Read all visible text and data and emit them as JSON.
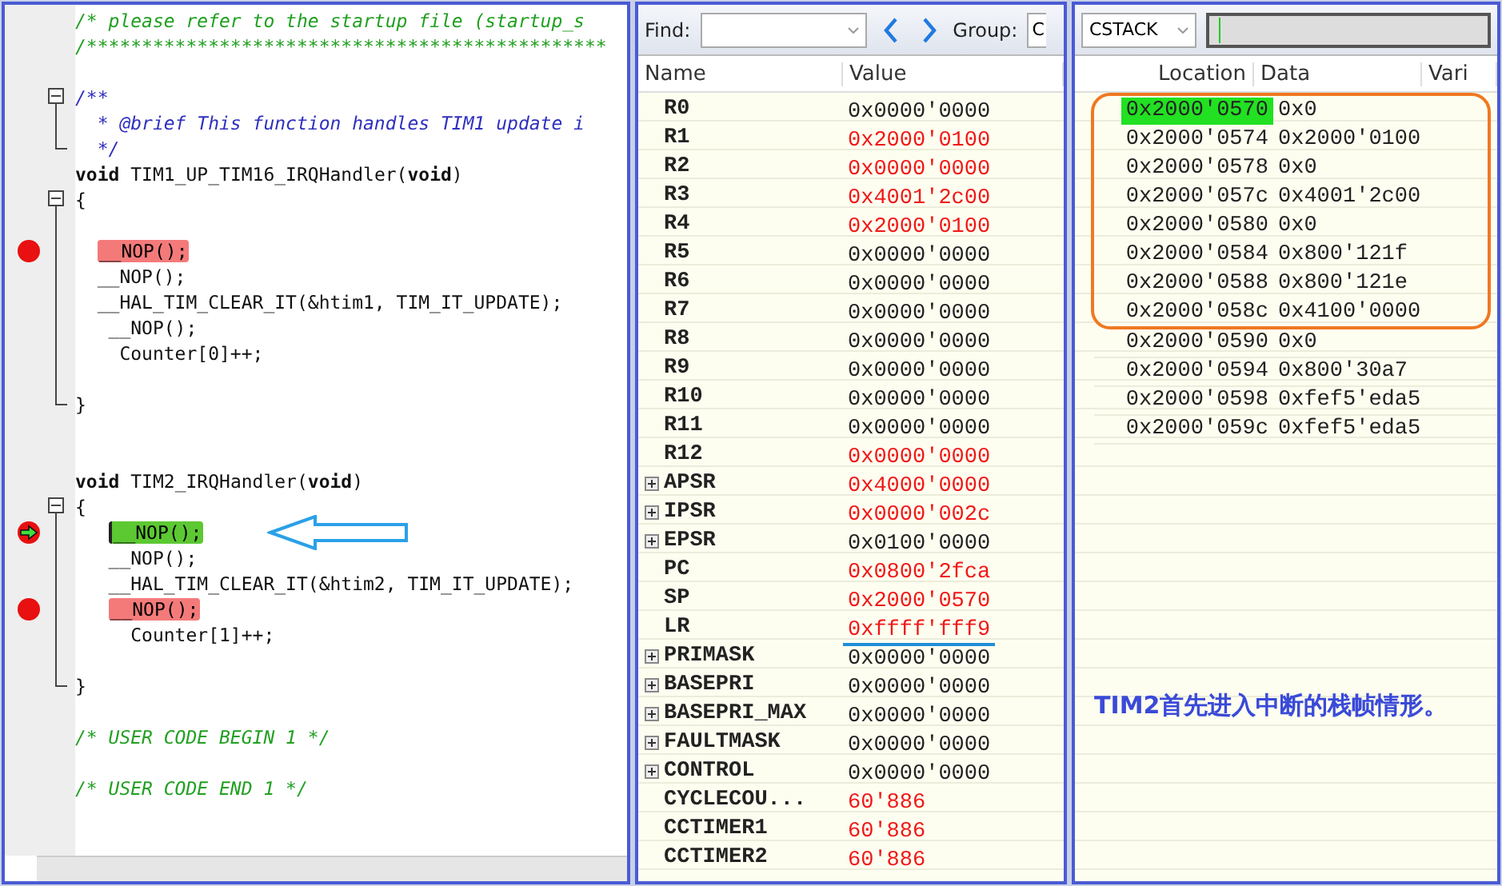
{
  "editor": {
    "lines": [
      {
        "kind": "comment",
        "text": "/* please refer to the startup file (startup_s"
      },
      {
        "kind": "comment",
        "text": "/***********************************************"
      },
      {
        "kind": "blank"
      },
      {
        "kind": "doc",
        "text": "/**",
        "fold_start": true
      },
      {
        "kind": "doc",
        "text": "  * @brief This function handles TIM1 update i",
        "fold_line": true
      },
      {
        "kind": "doc",
        "text": "  */",
        "fold_end": true
      },
      {
        "kind": "code",
        "text": "**void** TIM1_UP_TIM16_IRQHandler(**void**)"
      },
      {
        "kind": "code",
        "text": "{",
        "fold_start": true
      },
      {
        "kind": "blank",
        "fold_line": true
      },
      {
        "kind": "code",
        "text": "  __NOP();",
        "fold_line": true,
        "breakpoint": true
      },
      {
        "kind": "code",
        "text": "  __NOP();",
        "fold_line": true
      },
      {
        "kind": "code",
        "text": "  __HAL_TIM_CLEAR_IT(&htim1, TIM_IT_UPDATE);",
        "fold_line": true
      },
      {
        "kind": "code",
        "text": "   __NOP();",
        "fold_line": true
      },
      {
        "kind": "code",
        "text": "    Counter[0]++;",
        "fold_line": true
      },
      {
        "kind": "blank",
        "fold_line": true
      },
      {
        "kind": "code",
        "text": "}",
        "fold_end": true
      },
      {
        "kind": "blank"
      },
      {
        "kind": "blank"
      },
      {
        "kind": "code",
        "text": "**void** TIM2_IRQHandler(**void**)"
      },
      {
        "kind": "code",
        "text": "{",
        "fold_start": true
      },
      {
        "kind": "code",
        "text": "   __NOP();",
        "fold_line": true,
        "current": true,
        "pointed": true
      },
      {
        "kind": "code",
        "text": "   __NOP();",
        "fold_line": true
      },
      {
        "kind": "code",
        "text": "   __HAL_TIM_CLEAR_IT(&htim2, TIM_IT_UPDATE);",
        "fold_line": true
      },
      {
        "kind": "code",
        "text": "   __NOP();",
        "fold_line": true,
        "breakpoint": true
      },
      {
        "kind": "code",
        "text": "     Counter[1]++;",
        "fold_line": true
      },
      {
        "kind": "blank",
        "fold_line": true
      },
      {
        "kind": "code",
        "text": "}",
        "fold_end": true
      },
      {
        "kind": "blank"
      },
      {
        "kind": "comment",
        "text": "/* USER CODE BEGIN 1 */"
      },
      {
        "kind": "blank"
      },
      {
        "kind": "comment",
        "text": "/* USER CODE END 1 */"
      }
    ]
  },
  "registers": {
    "find_label": "Find:",
    "group_label": "Group:",
    "group_value": "C",
    "columns": [
      "Name",
      "Value"
    ],
    "rows": [
      {
        "name": "R0",
        "value": "0x0000'0000",
        "changed": false,
        "expandable": false
      },
      {
        "name": "R1",
        "value": "0x2000'0100",
        "changed": true,
        "expandable": false
      },
      {
        "name": "R2",
        "value": "0x0000'0000",
        "changed": true,
        "expandable": false
      },
      {
        "name": "R3",
        "value": "0x4001'2c00",
        "changed": true,
        "expandable": false
      },
      {
        "name": "R4",
        "value": "0x2000'0100",
        "changed": true,
        "expandable": false
      },
      {
        "name": "R5",
        "value": "0x0000'0000",
        "changed": false,
        "expandable": false
      },
      {
        "name": "R6",
        "value": "0x0000'0000",
        "changed": false,
        "expandable": false
      },
      {
        "name": "R7",
        "value": "0x0000'0000",
        "changed": false,
        "expandable": false
      },
      {
        "name": "R8",
        "value": "0x0000'0000",
        "changed": false,
        "expandable": false
      },
      {
        "name": "R9",
        "value": "0x0000'0000",
        "changed": false,
        "expandable": false
      },
      {
        "name": "R10",
        "value": "0x0000'0000",
        "changed": false,
        "expandable": false
      },
      {
        "name": "R11",
        "value": "0x0000'0000",
        "changed": false,
        "expandable": false
      },
      {
        "name": "R12",
        "value": "0x0000'0000",
        "changed": true,
        "expandable": false
      },
      {
        "name": "APSR",
        "value": "0x4000'0000",
        "changed": true,
        "expandable": true
      },
      {
        "name": "IPSR",
        "value": "0x0000'002c",
        "changed": true,
        "expandable": true
      },
      {
        "name": "EPSR",
        "value": "0x0100'0000",
        "changed": false,
        "expandable": true
      },
      {
        "name": "PC",
        "value": "0x0800'2fca",
        "changed": true,
        "expandable": false
      },
      {
        "name": "SP",
        "value": "0x2000'0570",
        "changed": true,
        "expandable": false
      },
      {
        "name": "LR",
        "value": "0xffff'fff9",
        "changed": true,
        "expandable": false,
        "underlined": true
      },
      {
        "name": "PRIMASK",
        "value": "0x0000'0000",
        "changed": false,
        "expandable": true
      },
      {
        "name": "BASEPRI",
        "value": "0x0000'0000",
        "changed": false,
        "expandable": true
      },
      {
        "name": "BASEPRI_MAX",
        "value": "0x0000'0000",
        "changed": false,
        "expandable": true
      },
      {
        "name": "FAULTMASK",
        "value": "0x0000'0000",
        "changed": false,
        "expandable": true
      },
      {
        "name": "CONTROL",
        "value": "0x0000'0000",
        "changed": false,
        "expandable": true
      },
      {
        "name": "CYCLECOU...",
        "value": "60'886",
        "changed": true,
        "expandable": false
      },
      {
        "name": "CCTIMER1",
        "value": "60'886",
        "changed": true,
        "expandable": false
      },
      {
        "name": "CCTIMER2",
        "value": "60'886",
        "changed": true,
        "expandable": false
      }
    ]
  },
  "stack": {
    "selector": "CSTACK",
    "columns": [
      "Location",
      "Data",
      "Vari"
    ],
    "rows": [
      {
        "location": "0x2000'0570",
        "data": "0x0",
        "selected": true,
        "framed": true
      },
      {
        "location": "0x2000'0574",
        "data": "0x2000'0100",
        "selected": false,
        "framed": true
      },
      {
        "location": "0x2000'0578",
        "data": "0x0",
        "selected": false,
        "framed": true
      },
      {
        "location": "0x2000'057c",
        "data": "0x4001'2c00",
        "selected": false,
        "framed": true
      },
      {
        "location": "0x2000'0580",
        "data": "0x0",
        "selected": false,
        "framed": true
      },
      {
        "location": "0x2000'0584",
        "data": "0x800'121f",
        "selected": false,
        "framed": true
      },
      {
        "location": "0x2000'0588",
        "data": "0x800'121e",
        "selected": false,
        "framed": true
      },
      {
        "location": "0x2000'058c",
        "data": "0x4100'0000",
        "selected": false,
        "framed": true
      },
      {
        "location": "0x2000'0590",
        "data": "0x0",
        "selected": false,
        "framed": false
      },
      {
        "location": "0x2000'0594",
        "data": "0x800'30a7",
        "selected": false,
        "framed": false
      },
      {
        "location": "0x2000'0598",
        "data": "0xfef5'eda5",
        "selected": false,
        "framed": false
      },
      {
        "location": "0x2000'059c",
        "data": "0xfef5'eda5",
        "selected": false,
        "framed": false
      }
    ],
    "note": "TIM2首先进入中断的栈帧情形。"
  }
}
